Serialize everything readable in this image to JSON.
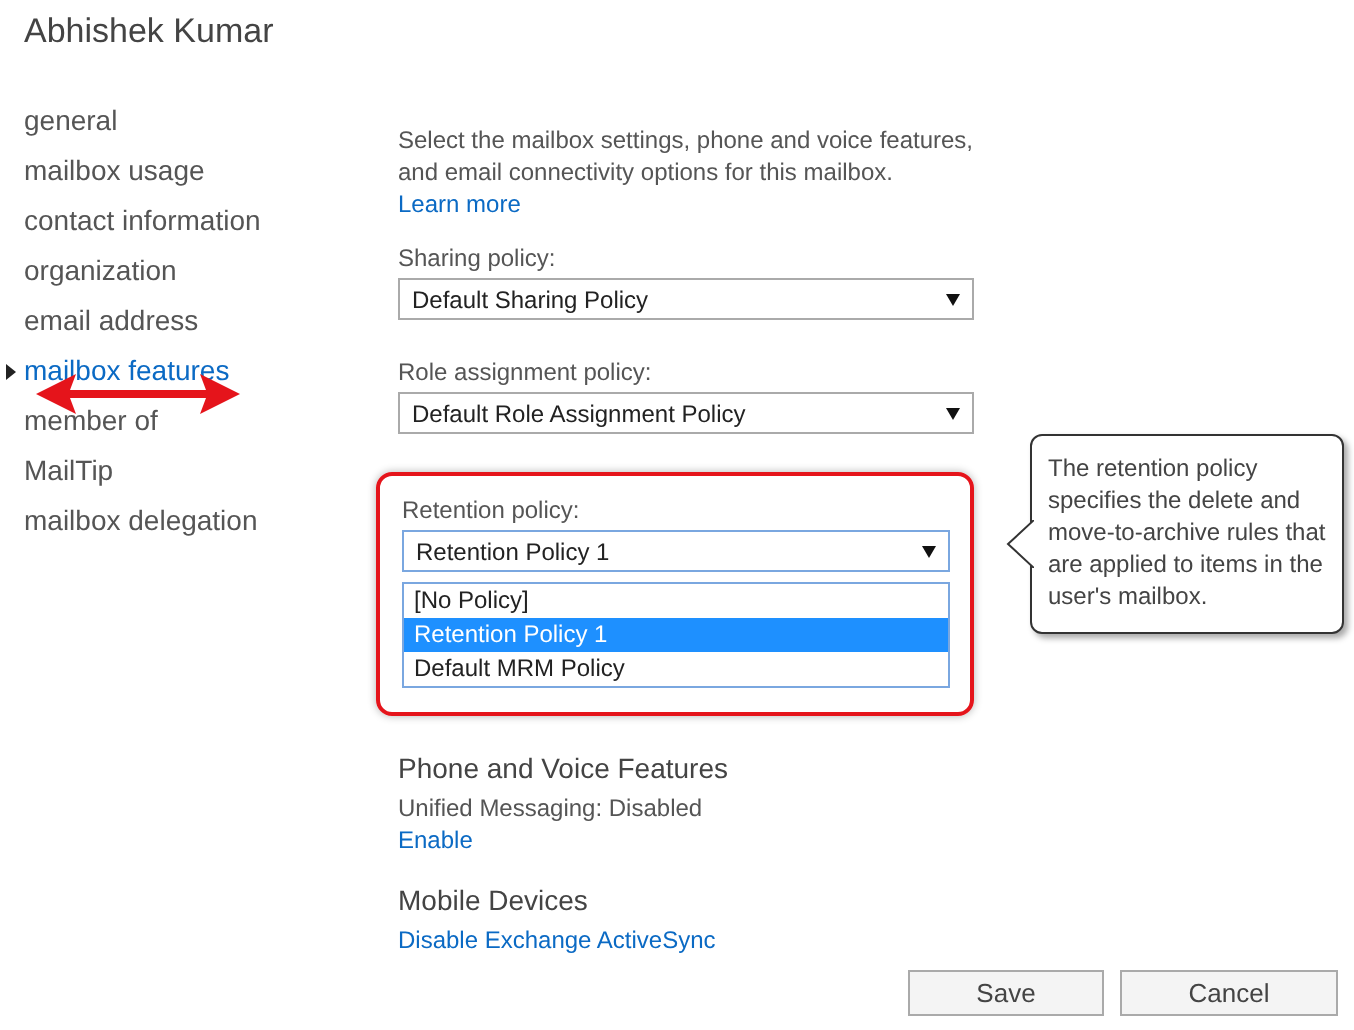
{
  "header": {
    "title": "Abhishek Kumar"
  },
  "nav": [
    {
      "label": "general",
      "selected": false
    },
    {
      "label": "mailbox usage",
      "selected": false
    },
    {
      "label": "contact information",
      "selected": false
    },
    {
      "label": "organization",
      "selected": false
    },
    {
      "label": "email address",
      "selected": false
    },
    {
      "label": "mailbox features",
      "selected": true
    },
    {
      "label": "member of",
      "selected": false
    },
    {
      "label": "MailTip",
      "selected": false
    },
    {
      "label": "mailbox delegation",
      "selected": false
    }
  ],
  "intro": {
    "text": "Select the mailbox settings, phone and voice features, and email connectivity options for this mailbox.",
    "link": "Learn more"
  },
  "fields": [
    {
      "label": "Sharing policy:",
      "value": "Default Sharing Policy",
      "open": false,
      "highlighted": false
    },
    {
      "label": "Role assignment policy:",
      "value": "Default Role Assignment Policy",
      "open": false,
      "highlighted": false
    },
    {
      "label": "Retention policy:",
      "value": "Retention Policy 1",
      "open": true,
      "highlighted": true,
      "options": [
        {
          "label": "[No Policy]",
          "selected": false
        },
        {
          "label": "Retention Policy 1",
          "selected": true
        },
        {
          "label": "Default MRM Policy",
          "selected": false
        }
      ]
    }
  ],
  "tooltip": {
    "text": "The retention policy specifies the delete and move-to-archive rules that are applied to items in the user's mailbox."
  },
  "sections": [
    {
      "title": "Phone and Voice Features",
      "status": "Unified Messaging: Disabled",
      "link": "Enable"
    },
    {
      "title": "Mobile Devices",
      "link": "Disable Exchange ActiveSync"
    }
  ],
  "buttons": [
    {
      "label": "Save"
    },
    {
      "label": "Cancel"
    }
  ]
}
